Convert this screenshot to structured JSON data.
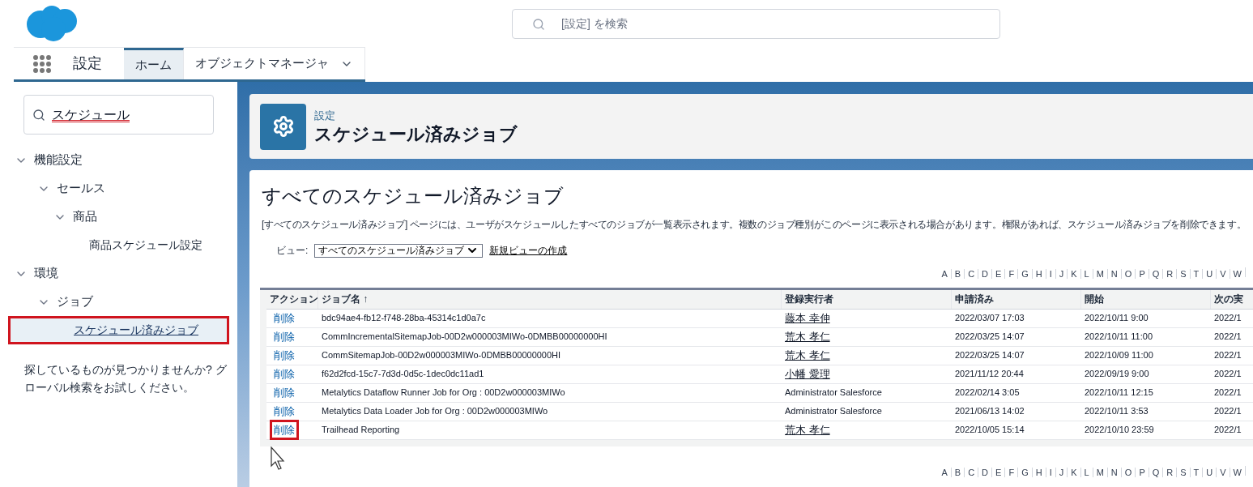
{
  "global_search": {
    "placeholder": "[設定] を検索"
  },
  "nav": {
    "app_name": "設定",
    "tabs": [
      {
        "label": "ホーム",
        "selected": true,
        "dropdown": false
      },
      {
        "label": "オブジェクトマネージャ",
        "selected": false,
        "dropdown": true
      }
    ]
  },
  "sidebar": {
    "search": {
      "value": "スケジュール",
      "spelling_error": true
    },
    "tree": [
      {
        "label": "機能設定",
        "expanded": true,
        "children": [
          {
            "label": "セールス",
            "expanded": true,
            "children": [
              {
                "label": "商品",
                "expanded": true,
                "children": [
                  {
                    "label": "商品スケジュール設定",
                    "selected": false,
                    "annotated": false
                  }
                ]
              }
            ]
          }
        ]
      },
      {
        "label": "環境",
        "expanded": true,
        "children": [
          {
            "label": "ジョブ",
            "expanded": true,
            "children": [
              {
                "label": "スケジュール済みジョブ",
                "selected": true,
                "annotated": true
              }
            ]
          }
        ]
      }
    ],
    "help": "探しているものが見つかりませんか? グローバル検索をお試しください。"
  },
  "header": {
    "breadcrumb": "設定",
    "title": "スケジュール済みジョブ"
  },
  "content": {
    "title": "すべてのスケジュール済みジョブ",
    "description": "[すべてのスケジュール済みジョブ] ページには、ユーザがスケジュールしたすべてのジョブが一覧表示されます。複数のジョブ種別がこのページに表示される場合があります。権限があれば、スケジュール済みジョブを削除できます。",
    "view_label": "ビュー:",
    "view_value": "すべてのスケジュール済みジョブ",
    "new_view_link": "新規ビューの作成",
    "alphabet_top": [
      "A",
      "B",
      "C",
      "D",
      "E",
      "F",
      "G",
      "H",
      "I",
      "J",
      "K",
      "L",
      "M",
      "N",
      "O",
      "P",
      "Q",
      "R",
      "S",
      "T",
      "U",
      "V",
      "W"
    ],
    "table": {
      "columns": [
        "アクション",
        "ジョブ名 ↑",
        "登録実行者",
        "申請済み",
        "開始",
        "次の実"
      ],
      "rows": [
        {
          "action": "削除",
          "action_annotated": false,
          "name": "bdc94ae4-fb12-f748-28ba-45314c1d0a7c",
          "user": "藤本 幸伸",
          "user_link": true,
          "submitted": "2022/03/07 17:03",
          "started": "2022/10/11 9:00",
          "next": "2022/1"
        },
        {
          "action": "削除",
          "action_annotated": false,
          "name": "CommIncrementalSitemapJob-00D2w000003MIWo-0DMBB00000000HI",
          "user": "荒木 孝仁",
          "user_link": true,
          "submitted": "2022/03/25 14:07",
          "started": "2022/10/11 11:00",
          "next": "2022/1"
        },
        {
          "action": "削除",
          "action_annotated": false,
          "name": "CommSitemapJob-00D2w000003MIWo-0DMBB00000000HI",
          "user": "荒木 孝仁",
          "user_link": true,
          "submitted": "2022/03/25 14:07",
          "started": "2022/10/09 11:00",
          "next": "2022/1"
        },
        {
          "action": "削除",
          "action_annotated": false,
          "name": "f62d2fcd-15c7-7d3d-0d5c-1dec0dc11ad1",
          "user": "小幡 愛理",
          "user_link": true,
          "submitted": "2021/11/12 20:44",
          "started": "2022/09/19 9:00",
          "next": "2022/1"
        },
        {
          "action": "削除",
          "action_annotated": false,
          "name": "Metalytics Dataflow Runner Job for Org : 00D2w000003MIWo",
          "user": "Administrator Salesforce",
          "user_link": false,
          "submitted": "2022/02/14 3:05",
          "started": "2022/10/11 12:15",
          "next": "2022/1"
        },
        {
          "action": "削除",
          "action_annotated": false,
          "name": "Metalytics Data Loader Job for Org : 00D2w000003MIWo",
          "user": "Administrator Salesforce",
          "user_link": false,
          "submitted": "2021/06/13 14:02",
          "started": "2022/10/11 3:53",
          "next": "2022/1"
        },
        {
          "action": "削除",
          "action_annotated": true,
          "name": "Trailhead Reporting",
          "user": "荒木 孝仁",
          "user_link": true,
          "submitted": "2022/10/05 15:14",
          "started": "2022/10/10 23:59",
          "next": "2022/1"
        }
      ]
    },
    "alphabet_bottom": [
      "A",
      "B",
      "C",
      "D",
      "E",
      "F",
      "G",
      "H",
      "I",
      "J",
      "K",
      "L",
      "M",
      "N",
      "O",
      "P",
      "Q",
      "R",
      "S",
      "T",
      "U",
      "V",
      "W"
    ]
  }
}
